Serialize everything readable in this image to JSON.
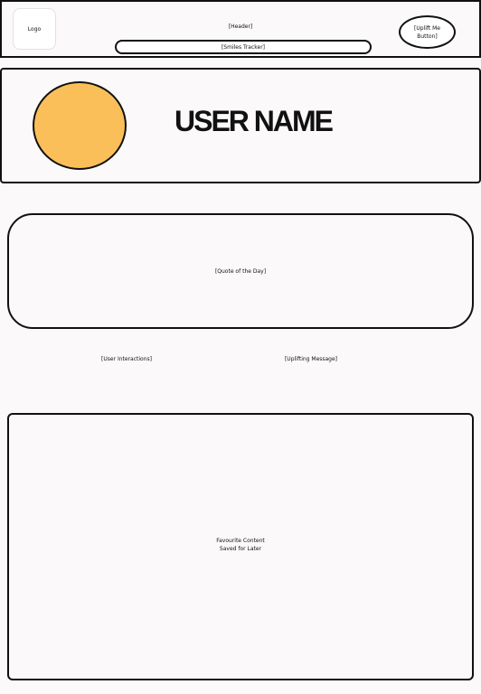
{
  "header": {
    "logo_label": "Logo",
    "title": "[Header]",
    "smiles_tracker": "[Smiles Tracker]",
    "uplift_button_label": "[Uplift Me Button]"
  },
  "profile": {
    "user_name": "USER NAME",
    "avatar_color": "#fbbf5a"
  },
  "quote": {
    "label": "[Quote of the Day]"
  },
  "sections": {
    "user_interactions": "[User Interactions]",
    "uplifting_message": "[Uplifting Message]"
  },
  "favourites": {
    "line1": "Favourite Content",
    "line2": "Saved for Later"
  }
}
